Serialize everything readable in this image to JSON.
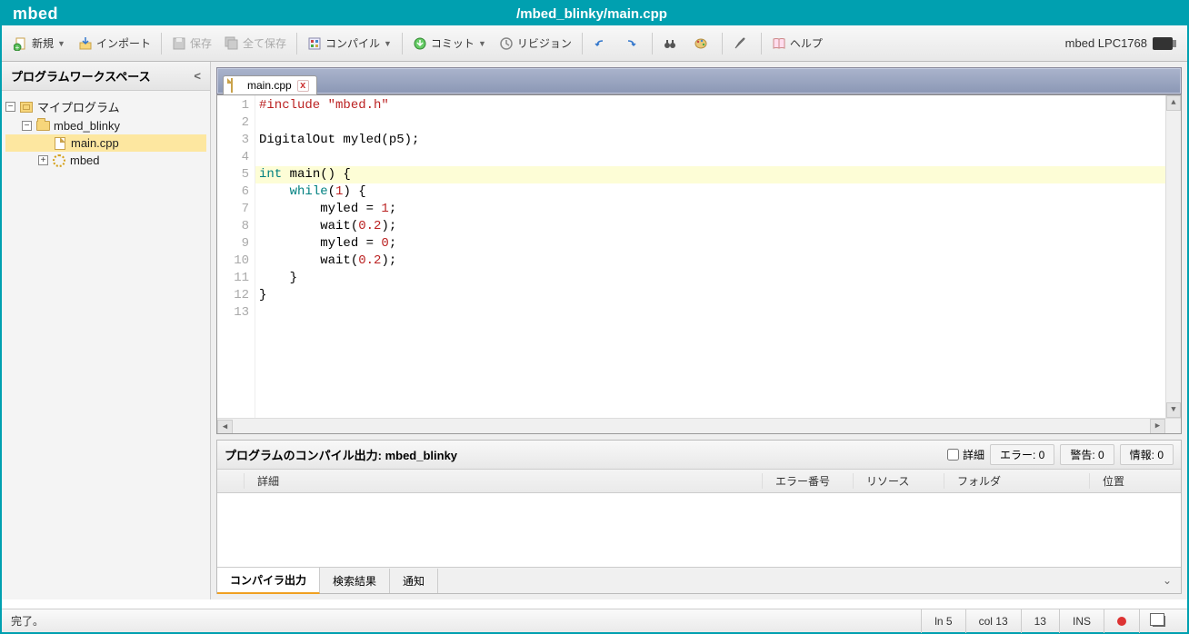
{
  "titlebar": {
    "logo": "mbed",
    "path": "/mbed_blinky/main.cpp"
  },
  "toolbar": {
    "new": "新規",
    "import": "インポート",
    "save": "保存",
    "save_all": "全て保存",
    "compile": "コンパイル",
    "commit": "コミット",
    "revision": "リビジョン",
    "help": "ヘルプ",
    "target": "mbed LPC1768"
  },
  "sidebar": {
    "header": "プログラムワークスペース",
    "tree": {
      "root": "マイプログラム",
      "project": "mbed_blinky",
      "file": "main.cpp",
      "lib": "mbed"
    }
  },
  "tabs": {
    "active": "main.cpp"
  },
  "code": {
    "lines": [
      {
        "n": 1,
        "html": "<span class='pp'>#include</span> <span class='str'>\"mbed.h\"</span>"
      },
      {
        "n": 2,
        "html": ""
      },
      {
        "n": 3,
        "html": "DigitalOut myled(p5);"
      },
      {
        "n": 4,
        "html": ""
      },
      {
        "n": 5,
        "html": "<span class='kw'>int</span> main() {",
        "hl": true
      },
      {
        "n": 6,
        "html": "    <span class='kw'>while</span>(<span class='num'>1</span>) {"
      },
      {
        "n": 7,
        "html": "        myled = <span class='num'>1</span>;"
      },
      {
        "n": 8,
        "html": "        wait(<span class='num'>0.2</span>);"
      },
      {
        "n": 9,
        "html": "        myled = <span class='num'>0</span>;"
      },
      {
        "n": 10,
        "html": "        wait(<span class='num'>0.2</span>);"
      },
      {
        "n": 11,
        "html": "    }"
      },
      {
        "n": 12,
        "html": "}"
      },
      {
        "n": 13,
        "html": ""
      }
    ]
  },
  "output": {
    "title_prefix": "プログラムのコンパイル出力: ",
    "title_project": "mbed_blinky",
    "detail_label": "詳細",
    "errors": "エラー: 0",
    "warnings": "警告: 0",
    "infos": "情報: 0",
    "cols": {
      "detail": "詳細",
      "errno": "エラー番号",
      "resource": "リソース",
      "folder": "フォルダ",
      "location": "位置"
    },
    "tabs": {
      "compiler": "コンパイラ出力",
      "search": "検索結果",
      "notify": "通知"
    }
  },
  "status": {
    "message": "完了。",
    "ln": "ln 5",
    "col": "col 13",
    "total": "13",
    "ins": "INS"
  }
}
